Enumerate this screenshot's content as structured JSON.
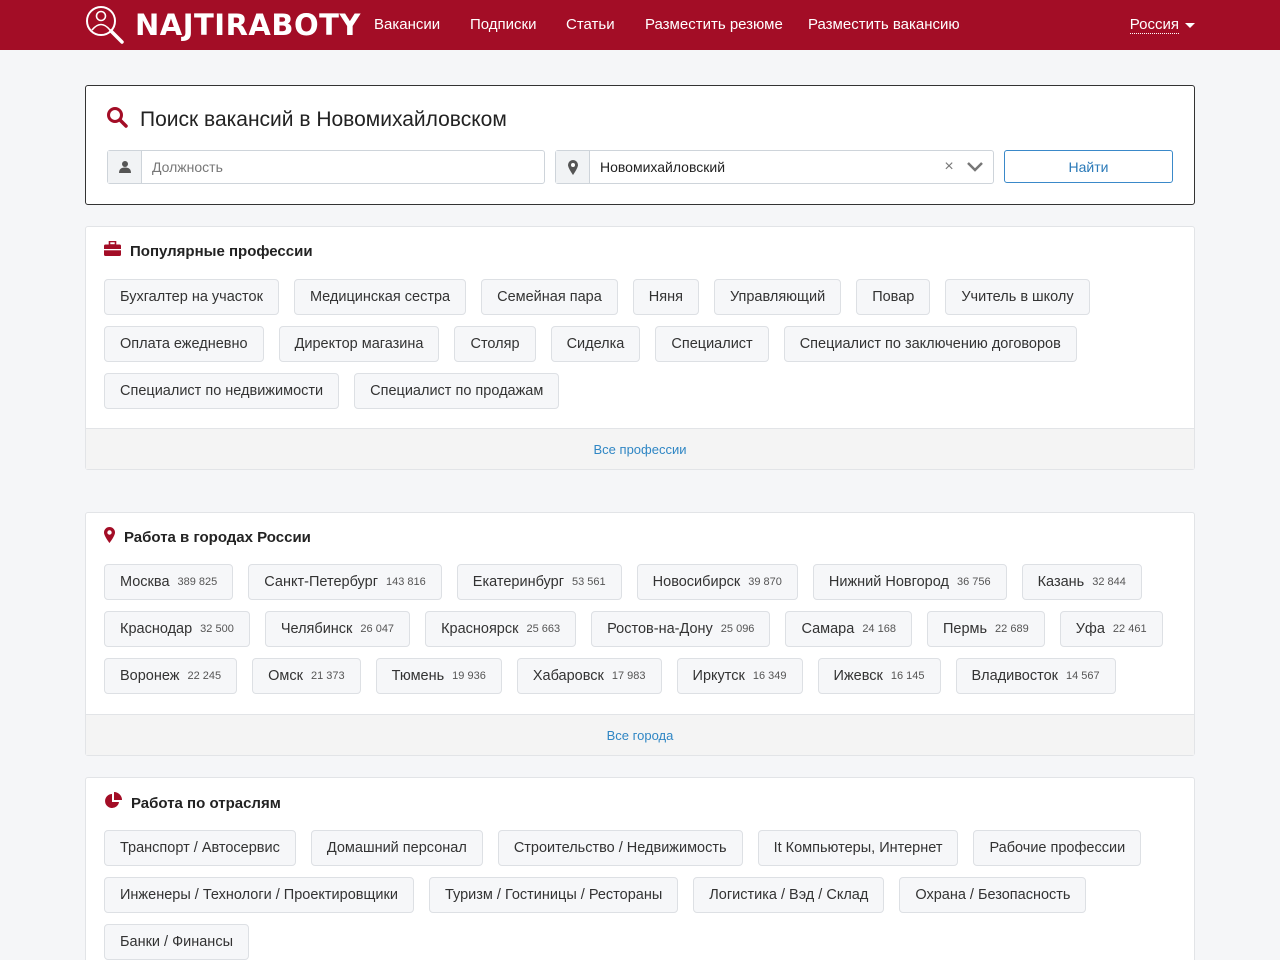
{
  "header": {
    "logo_text": "NAJTIRABOTY",
    "nav": [
      "Вакансии",
      "Подписки",
      "Статьи",
      "Разместить резюме",
      "Разместить вакансию"
    ],
    "region": "Россия"
  },
  "search": {
    "title": "Поиск вакансий в Новомихайловском",
    "position_placeholder": "Должность",
    "position_value": "",
    "city_value": "Новомихайловский",
    "clear_symbol": "×",
    "button": "Найти"
  },
  "professions": {
    "title": "Популярные профессии",
    "items": [
      "Бухгалтер на участок",
      "Медицинская сестра",
      "Семейная пара",
      "Няня",
      "Управляющий",
      "Повар",
      "Учитель в школу",
      "Оплата ежедневно",
      "Директор магазина",
      "Столяр",
      "Сиделка",
      "Специалист",
      "Специалист по заключению договоров",
      "Специалист по недвижимости",
      "Специалист по продажам"
    ],
    "all_link": "Все профессии"
  },
  "cities": {
    "title": "Работа в городах России",
    "items": [
      {
        "name": "Москва",
        "count": "389 825"
      },
      {
        "name": "Санкт-Петербург",
        "count": "143 816"
      },
      {
        "name": "Екатеринбург",
        "count": "53 561"
      },
      {
        "name": "Новосибирск",
        "count": "39 870"
      },
      {
        "name": "Нижний Новгород",
        "count": "36 756"
      },
      {
        "name": "Казань",
        "count": "32 844"
      },
      {
        "name": "Краснодар",
        "count": "32 500"
      },
      {
        "name": "Челябинск",
        "count": "26 047"
      },
      {
        "name": "Красноярск",
        "count": "25 663"
      },
      {
        "name": "Ростов-на-Дону",
        "count": "25 096"
      },
      {
        "name": "Самара",
        "count": "24 168"
      },
      {
        "name": "Пермь",
        "count": "22 689"
      },
      {
        "name": "Уфа",
        "count": "22 461"
      },
      {
        "name": "Воронеж",
        "count": "22 245"
      },
      {
        "name": "Омск",
        "count": "21 373"
      },
      {
        "name": "Тюмень",
        "count": "19 936"
      },
      {
        "name": "Хабаровск",
        "count": "17 983"
      },
      {
        "name": "Иркутск",
        "count": "16 349"
      },
      {
        "name": "Ижевск",
        "count": "16 145"
      },
      {
        "name": "Владивосток",
        "count": "14 567"
      }
    ],
    "all_link": "Все города"
  },
  "industries": {
    "title": "Работа по отраслям",
    "items": [
      "Транспорт / Автосервис",
      "Домашний персонал",
      "Строительство / Недвижимость",
      "It Компьютеры, Интернет",
      "Рабочие профессии",
      "Инженеры / Технологи / Проектировщики",
      "Туризм / Гостиницы / Рестораны",
      "Логистика / Вэд / Склад",
      "Охрана / Безопасность",
      "Банки / Финансы"
    ]
  },
  "colors": {
    "brand": "#a30d26",
    "link": "#2f86c4"
  },
  "icons": {
    "logo": "magnifier-person-icon",
    "search": "search-icon",
    "position": "user-icon",
    "location": "map-marker-icon",
    "chevron": "chevron-down-icon",
    "professions": "briefcase-icon",
    "cities": "map-marker-icon",
    "industries": "pie-chart-icon"
  }
}
